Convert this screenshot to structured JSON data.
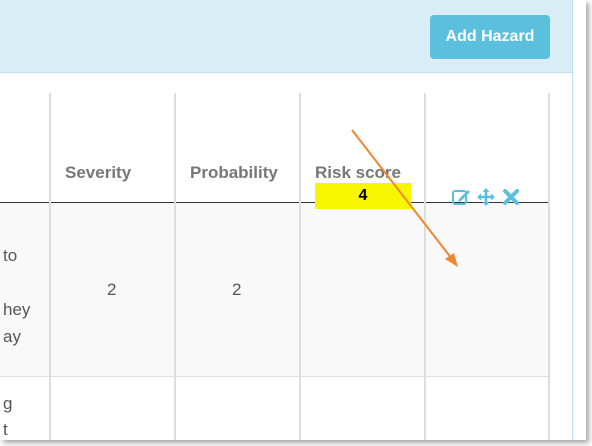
{
  "toolbar": {
    "add_hazard_label": "Add Hazard"
  },
  "table": {
    "headers": {
      "severity": "Severity",
      "probability": "Probability",
      "risk_score": "Risk score"
    },
    "row1": {
      "left_fragments": [
        "to",
        "hey",
        "ay"
      ],
      "severity": "2",
      "probability": "2",
      "risk_score": "4"
    },
    "row2": {
      "left_fragments": [
        "g",
        "t"
      ]
    }
  },
  "icons": {
    "edit": "edit-icon",
    "move": "move-icon",
    "delete": "delete-icon"
  },
  "colors": {
    "header_bg": "#d9edf7",
    "button_bg": "#5bc0de",
    "risk_highlight": "#f6f600",
    "action_icons": "#5bc0de",
    "annotation_arrow": "#f0872f"
  }
}
